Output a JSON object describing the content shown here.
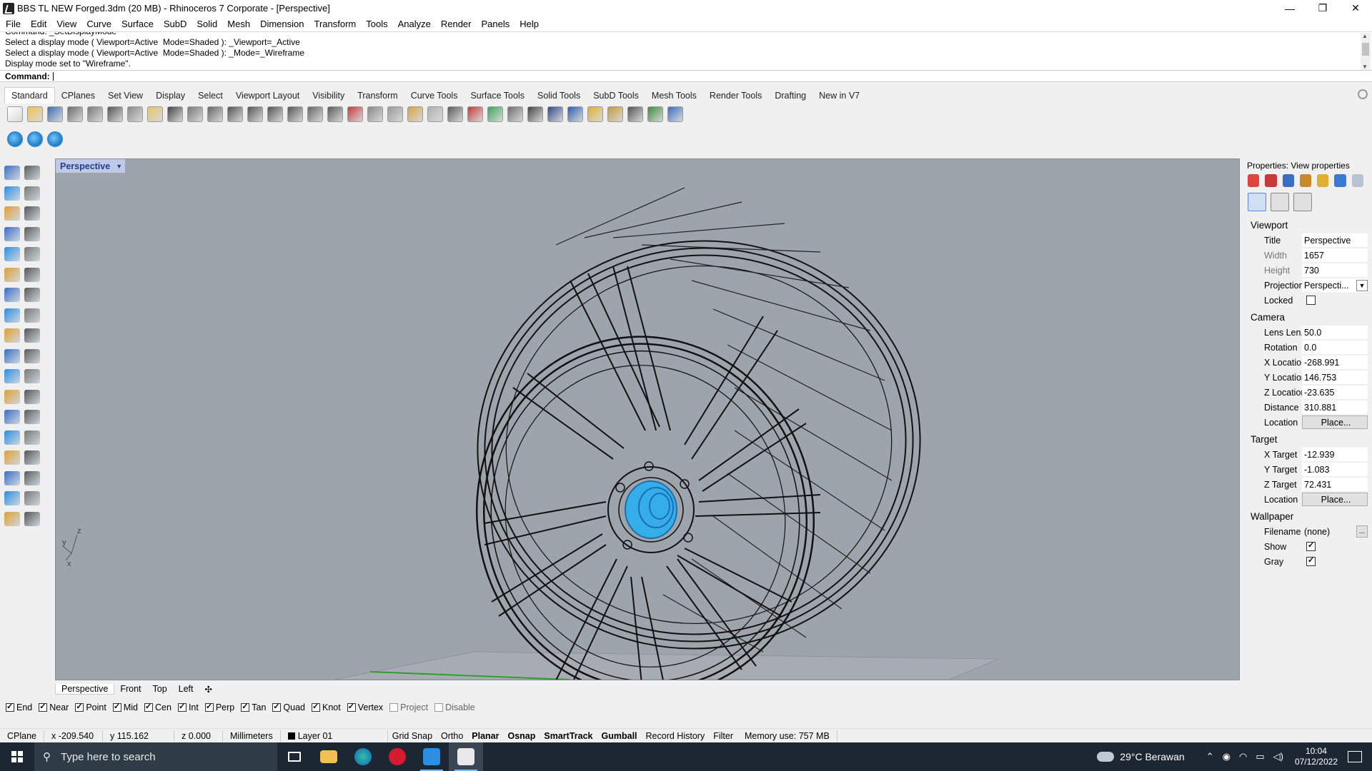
{
  "window": {
    "title": "BBS TL NEW Forged.3dm (20 MB) - Rhinoceros 7 Corporate - [Perspective]",
    "minimize": "—",
    "maximize": "❐",
    "close": "✕"
  },
  "menubar": [
    "File",
    "Edit",
    "View",
    "Curve",
    "Surface",
    "SubD",
    "Solid",
    "Mesh",
    "Dimension",
    "Transform",
    "Tools",
    "Analyze",
    "Render",
    "Panels",
    "Help"
  ],
  "command_history": [
    "Command: _SetDisplayMode",
    "Select a display mode ( Viewport=Active  Mode=Shaded ): _Viewport=_Active",
    "Select a display mode ( Viewport=Active  Mode=Shaded ): _Mode=_Wireframe",
    "Display mode set to \"Wireframe\"."
  ],
  "command_prompt": {
    "label": "Command:",
    "value": ""
  },
  "toolbar_tabs": [
    {
      "label": "Standard",
      "active": true
    },
    {
      "label": "CPlanes"
    },
    {
      "label": "Set View"
    },
    {
      "label": "Display"
    },
    {
      "label": "Select"
    },
    {
      "label": "Viewport Layout"
    },
    {
      "label": "Visibility"
    },
    {
      "label": "Transform"
    },
    {
      "label": "Curve Tools"
    },
    {
      "label": "Surface Tools"
    },
    {
      "label": "Solid Tools"
    },
    {
      "label": "SubD Tools"
    },
    {
      "label": "Mesh Tools"
    },
    {
      "label": "Render Tools"
    },
    {
      "label": "Drafting"
    },
    {
      "label": "New in V7"
    }
  ],
  "toolbar_icons": [
    {
      "name": "new-icon",
      "color": "#ffffff"
    },
    {
      "name": "open-icon",
      "color": "#f2c14e"
    },
    {
      "name": "save-icon",
      "color": "#3b6db3"
    },
    {
      "name": "print-icon",
      "color": "#6b6b6b"
    },
    {
      "name": "import-icon",
      "color": "#7a7a7a"
    },
    {
      "name": "cut-icon",
      "color": "#555555"
    },
    {
      "name": "copy-icon",
      "color": "#8a8a8a"
    },
    {
      "name": "paste-icon",
      "color": "#e6c46a"
    },
    {
      "name": "undo-icon",
      "color": "#444444"
    },
    {
      "name": "pan-icon",
      "color": "#777777"
    },
    {
      "name": "rotate-view-icon",
      "color": "#666666"
    },
    {
      "name": "zoom-icon",
      "color": "#555555"
    },
    {
      "name": "zoom-window-icon",
      "color": "#555555"
    },
    {
      "name": "zoom-extents-icon",
      "color": "#555555"
    },
    {
      "name": "zoom-selected-icon",
      "color": "#555555"
    },
    {
      "name": "undo-view-icon",
      "color": "#666666"
    },
    {
      "name": "four-view-icon",
      "color": "#5a5a5a"
    },
    {
      "name": "car-icon",
      "color": "#c43a3a"
    },
    {
      "name": "cplane-icon",
      "color": "#888888"
    },
    {
      "name": "circle-icon",
      "color": "#999999"
    },
    {
      "name": "select-points-icon",
      "color": "#d9a441"
    },
    {
      "name": "light-icon",
      "color": "#b0b0b0"
    },
    {
      "name": "lock-icon",
      "color": "#5a5a5a"
    },
    {
      "name": "material-icon",
      "color": "#c73a3a"
    },
    {
      "name": "color-wheel-icon",
      "color": "#3aa55a"
    },
    {
      "name": "shaded-sphere-icon",
      "color": "#6e6e6e"
    },
    {
      "name": "rendered-sphere-icon",
      "color": "#444444"
    },
    {
      "name": "render-sphere-icon",
      "color": "#2e4a8a"
    },
    {
      "name": "render-icon",
      "color": "#2b5fb0"
    },
    {
      "name": "properties-icon",
      "color": "#e0b030"
    },
    {
      "name": "options-icon",
      "color": "#c49a3a"
    },
    {
      "name": "dimension-icon",
      "color": "#555555"
    },
    {
      "name": "globe-icon",
      "color": "#3a8a3a"
    },
    {
      "name": "help-icon",
      "color": "#3a6ec4"
    }
  ],
  "toolbar2_icons": [
    "sync-icon-1",
    "sync-icon-2",
    "sync-icon-3"
  ],
  "viewport": {
    "label": "Perspective",
    "display_mode": "Wireframe",
    "axis_labels": {
      "z": "z",
      "y": "y",
      "x": "x"
    }
  },
  "viewport_tabs": [
    {
      "label": "Perspective",
      "active": true
    },
    {
      "label": "Front"
    },
    {
      "label": "Top"
    },
    {
      "label": "Left"
    },
    {
      "label": "✣"
    }
  ],
  "osnaps": [
    {
      "label": "End",
      "on": true
    },
    {
      "label": "Near",
      "on": true
    },
    {
      "label": "Point",
      "on": true
    },
    {
      "label": "Mid",
      "on": true
    },
    {
      "label": "Cen",
      "on": true
    },
    {
      "label": "Int",
      "on": true
    },
    {
      "label": "Perp",
      "on": true
    },
    {
      "label": "Tan",
      "on": true
    },
    {
      "label": "Quad",
      "on": true
    },
    {
      "label": "Knot",
      "on": true
    },
    {
      "label": "Vertex",
      "on": true
    },
    {
      "label": "Project",
      "on": false
    },
    {
      "label": "Disable",
      "on": false
    }
  ],
  "statusbar": {
    "cplane": "CPlane",
    "x": "x -209.540",
    "y": "y 115.162",
    "z": "z 0.000",
    "units": "Millimeters",
    "layer": "Layer 01",
    "toggles": [
      {
        "label": "Grid Snap",
        "bold": false
      },
      {
        "label": "Ortho",
        "bold": false
      },
      {
        "label": "Planar",
        "bold": true
      },
      {
        "label": "Osnap",
        "bold": true
      },
      {
        "label": "SmartTrack",
        "bold": true
      },
      {
        "label": "Gumball",
        "bold": true
      },
      {
        "label": "Record History",
        "bold": false
      },
      {
        "label": "Filter",
        "bold": false
      }
    ],
    "memory": "Memory use: 757 MB"
  },
  "properties": {
    "header": "Properties: View properties",
    "icons": [
      "color-icon",
      "material-icon",
      "render-icon",
      "brush-icon",
      "folder-icon",
      "image-icon",
      "more-icon"
    ],
    "big_icons": [
      "camera-icon",
      "wrench-icon",
      "frame-icon"
    ],
    "groups": {
      "viewport": {
        "label": "Viewport",
        "title": {
          "k": "Title",
          "v": "Perspective"
        },
        "width": {
          "k": "Width",
          "v": "1657"
        },
        "height": {
          "k": "Height",
          "v": "730"
        },
        "projection": {
          "k": "Projection",
          "v": "Perspecti..."
        },
        "locked": {
          "k": "Locked",
          "v": false
        }
      },
      "camera": {
        "label": "Camera",
        "lens": {
          "k": "Lens Len...",
          "v": "50.0"
        },
        "rotation": {
          "k": "Rotation",
          "v": "0.0"
        },
        "xloc": {
          "k": "X Location",
          "v": "-268.991"
        },
        "yloc": {
          "k": "Y Location",
          "v": "146.753"
        },
        "zloc": {
          "k": "Z Location",
          "v": "-23.635"
        },
        "distance": {
          "k": "Distance ...",
          "v": "310.881"
        },
        "location": {
          "k": "Location",
          "v": "Place..."
        }
      },
      "target": {
        "label": "Target",
        "xt": {
          "k": "X Target",
          "v": "-12.939"
        },
        "yt": {
          "k": "Y Target",
          "v": "-1.083"
        },
        "zt": {
          "k": "Z Target",
          "v": "72.431"
        },
        "location": {
          "k": "Location",
          "v": "Place..."
        }
      },
      "wallpaper": {
        "label": "Wallpaper",
        "filename": {
          "k": "Filename",
          "v": "(none)",
          "btn": "..."
        },
        "show": {
          "k": "Show",
          "v": true
        },
        "gray": {
          "k": "Gray",
          "v": true
        }
      }
    }
  },
  "taskbar": {
    "search_placeholder": "Type here to search",
    "apps": [
      "task-view-icon",
      "file-explorer-icon",
      "edge-icon",
      "opera-icon",
      "photos-icon",
      "rhino-icon"
    ],
    "weather": "29°C  Berawan",
    "time": "10:04",
    "date": "07/12/2022"
  }
}
